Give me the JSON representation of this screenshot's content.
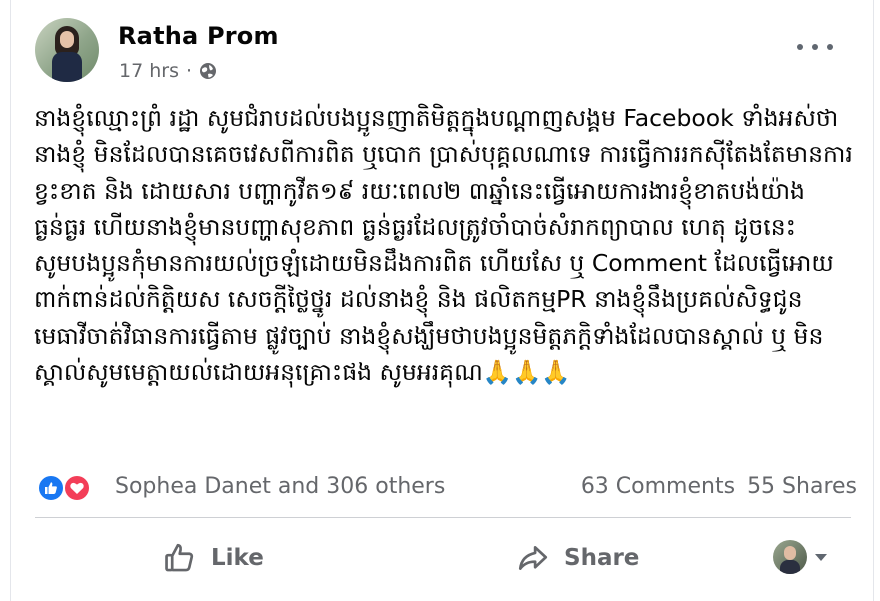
{
  "post": {
    "author": "Ratha Prom",
    "time": "17 hrs",
    "separator": "·",
    "privacy_icon": "globe-icon",
    "menu_icon": "more-options-icon",
    "text": "នាងខ្ញុំឈ្មោះព្រំ រដ្ឋា សូមជំរាបដល់បងប្អូនញាតិមិត្តក្នុងបណ្ដាញសង្គម Facebook ទាំងអស់ថានាងខ្ញុំ មិនដែលបានគេចវេសពីការពិត ឬបោក ប្រាស់បុគ្គលណាទេ ការធ្វើការរកស៊ីតែងតែមានការខ្វះខាត និង ដោយសារ បញ្ហាកូវីត១៩ រយៈពេល២ ៣ឆ្នាំនេះធ្វើអោយការងារខ្ញុំខាតបង់យ៉ាងធ្ងន់ធ្ងរ ហើយនាងខ្ញុំមានបញ្ហាសុខភាព ធ្ងន់ធ្ងរដែលត្រូវចាំបាច់សំរាកព្យាបាល ហេតុ ដូចនេះសូមបងប្អូនកុំមានការយល់ច្រឡំដោយមិនដឹងការពិត ហើយសែ ឬ Comment ដែលធ្វើអោយពាក់ពាន់ដល់កិត្តិយស សេចក្តីថ្លៃថ្នូរ ដល់នាងខ្ញុំ និង ផលិតកម្មPR  នាងខ្ញុំនឹងប្រគល់សិទ្ធជូនមេធាវីចាត់វិធានការធ្វើតាម ផ្លូវច្បាប់ នាងខ្ញុំសង្ឃឹមថាបងប្អូនមិត្តភក្តិទាំងដែលបានស្គាល់ ឬ មិន ស្គាល់សូមមេត្តាយល់ដោយអនុគ្រោះផង  សូមអរគុណ🙏🙏🙏"
  },
  "reactions": {
    "icons": [
      "like-reaction-icon",
      "love-reaction-icon"
    ],
    "names": "Sophea Danet and 306 others",
    "comments": "63 Comments",
    "shares": "55 Shares"
  },
  "actions": {
    "like_label": "Like",
    "share_label": "Share"
  },
  "colors": {
    "like_blue": "#1877f2",
    "love_red": "#f33e58",
    "secondary_text": "#65676b"
  }
}
